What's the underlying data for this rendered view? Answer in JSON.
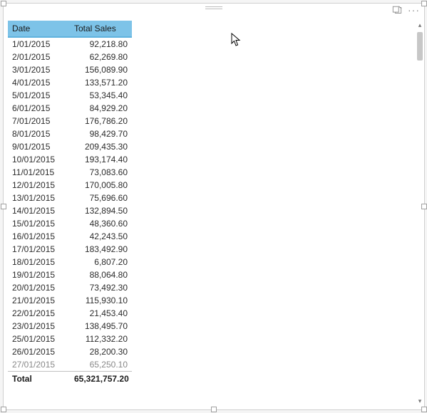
{
  "header": {
    "focus_tooltip": "Focus mode",
    "more_tooltip": "More options"
  },
  "table": {
    "columns": {
      "date": "Date",
      "total_sales": "Total Sales"
    },
    "rows": [
      {
        "date": "1/01/2015",
        "sales": "92,218.80"
      },
      {
        "date": "2/01/2015",
        "sales": "62,269.80"
      },
      {
        "date": "3/01/2015",
        "sales": "156,089.90"
      },
      {
        "date": "4/01/2015",
        "sales": "133,571.20"
      },
      {
        "date": "5/01/2015",
        "sales": "53,345.40"
      },
      {
        "date": "6/01/2015",
        "sales": "84,929.20"
      },
      {
        "date": "7/01/2015",
        "sales": "176,786.20"
      },
      {
        "date": "8/01/2015",
        "sales": "98,429.70"
      },
      {
        "date": "9/01/2015",
        "sales": "209,435.30"
      },
      {
        "date": "10/01/2015",
        "sales": "193,174.40"
      },
      {
        "date": "11/01/2015",
        "sales": "73,083.60"
      },
      {
        "date": "12/01/2015",
        "sales": "170,005.80"
      },
      {
        "date": "13/01/2015",
        "sales": "75,696.60"
      },
      {
        "date": "14/01/2015",
        "sales": "132,894.50"
      },
      {
        "date": "15/01/2015",
        "sales": "48,360.60"
      },
      {
        "date": "16/01/2015",
        "sales": "42,243.50"
      },
      {
        "date": "17/01/2015",
        "sales": "183,492.90"
      },
      {
        "date": "18/01/2015",
        "sales": "6,807.20"
      },
      {
        "date": "19/01/2015",
        "sales": "88,064.80"
      },
      {
        "date": "20/01/2015",
        "sales": "73,492.30"
      },
      {
        "date": "21/01/2015",
        "sales": "115,930.10"
      },
      {
        "date": "22/01/2015",
        "sales": "21,453.40"
      },
      {
        "date": "23/01/2015",
        "sales": "138,495.70"
      },
      {
        "date": "25/01/2015",
        "sales": "112,332.20"
      },
      {
        "date": "26/01/2015",
        "sales": "28,200.30"
      },
      {
        "date": "27/01/2015",
        "sales": "65,250.10"
      }
    ],
    "footer": {
      "label": "Total",
      "value": "65,321,757.20"
    }
  }
}
